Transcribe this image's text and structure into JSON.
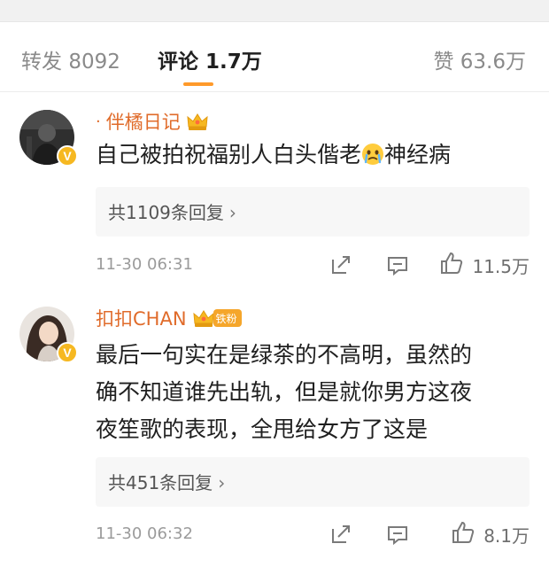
{
  "tabs": {
    "repost_label": "转发",
    "repost_count": "8092",
    "comment_label": "评论",
    "comment_count": "1.7万",
    "like_label": "赞",
    "like_count": "63.6万"
  },
  "colors": {
    "accent": "#ff9a2a",
    "username": "#e06b2a",
    "badge": "#f6b821"
  },
  "comments": [
    {
      "username": "伴橘日记",
      "prefix_dot": "·",
      "level_icon": "crown-icon",
      "verified_icon": "verified-v-icon",
      "text_before_emoji": "自己被拍祝福别人白头偕老",
      "emoji": "crying-face-emoji",
      "text_after_emoji": "神经病",
      "reply_summary": "共1109条回复",
      "time": "11-30 06:31",
      "likes": "11.5万"
    },
    {
      "username": "扣扣CHAN",
      "level_icon": "crown-icon",
      "fan_badge": "铁粉",
      "verified_icon": "verified-v-icon",
      "text": "最后一句实在是绿茶的不高明，虽然的\n确不知道谁先出轨，但是就你男方这夜\n夜笙歌的表现，全甩给女方了这是",
      "reply_summary": "共451条回复",
      "time": "11-30 06:32",
      "likes": "8.1万"
    }
  ]
}
